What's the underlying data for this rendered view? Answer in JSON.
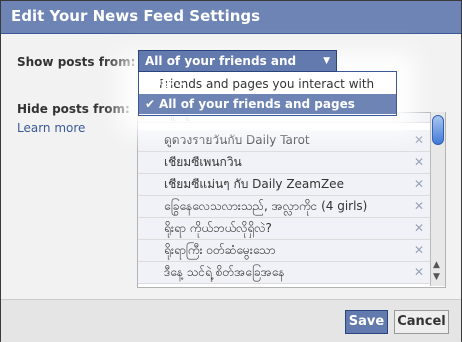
{
  "dialog": {
    "title": "Edit Your News Feed Settings",
    "show_posts_label": "Show posts from:",
    "hide_posts_label": "Hide posts from:",
    "learn_more": "Learn more"
  },
  "show_select": {
    "value": "All of your friends and pag...",
    "options": [
      {
        "label": "Friends and pages you interact with most",
        "selected": false
      },
      {
        "label": "All of your friends and pages",
        "selected": true
      }
    ]
  },
  "hidden_list": [
    {
      "name": "ดูดวงรายวันกับ Daily Tarot"
    },
    {
      "name": "เชียมซีเพนกวิน"
    },
    {
      "name": "เชียมซีแม่นๆ กับ Daily ZeamZee"
    },
    {
      "name": "ခြွေနေလေသလားသည်, အလ္လာကိုင (4 girls)"
    },
    {
      "name": "ရိုးရာ ကိုယ်ဘယ်လိုရှိလဲ?"
    },
    {
      "name": "ရိုးရာကြီး ဝတ်ဆံမွေးသော"
    },
    {
      "name": "ဒီနေ့ သင်ရဲ့ စိတ်အခြေအနေ"
    }
  ],
  "buttons": {
    "save": "Save",
    "cancel": "Cancel"
  },
  "colors": {
    "accent": "#627aad",
    "titlebar": "#6d84b4"
  }
}
